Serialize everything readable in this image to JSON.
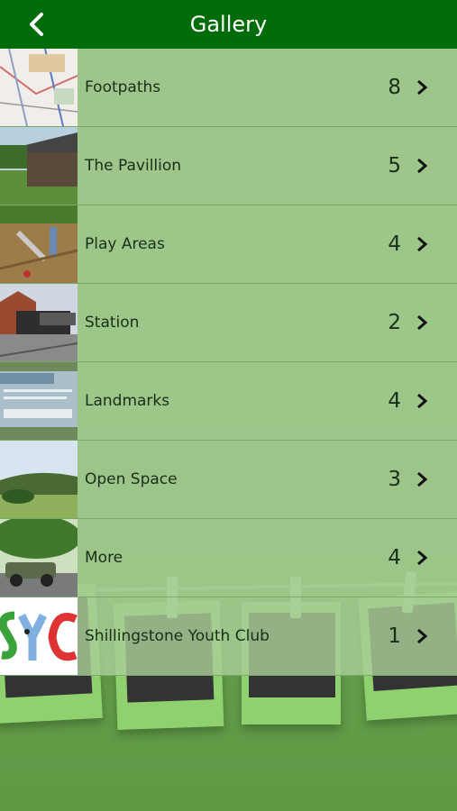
{
  "header": {
    "title": "Gallery",
    "back_icon": "chevron-left-icon"
  },
  "items": [
    {
      "label": "Footpaths",
      "count": "8",
      "thumb": "map-thumbnail"
    },
    {
      "label": "The Pavillion",
      "count": "5",
      "thumb": "pavilion-thumbnail"
    },
    {
      "label": "Play Areas",
      "count": "4",
      "thumb": "play-area-thumbnail"
    },
    {
      "label": "Station",
      "count": "2",
      "thumb": "station-thumbnail"
    },
    {
      "label": "Landmarks",
      "count": "4",
      "thumb": "trailway-sign-thumbnail"
    },
    {
      "label": "Open Space",
      "count": "3",
      "thumb": "open-space-thumbnail"
    },
    {
      "label": "More",
      "count": "4",
      "thumb": "vintage-car-thumbnail"
    },
    {
      "label": "Shillingstone Youth Club",
      "count": "1",
      "thumb": "syc-logo-thumbnail"
    }
  ],
  "colors": {
    "header": "#026b0a",
    "row": "#a8cd96",
    "background": "#6aa34f"
  }
}
